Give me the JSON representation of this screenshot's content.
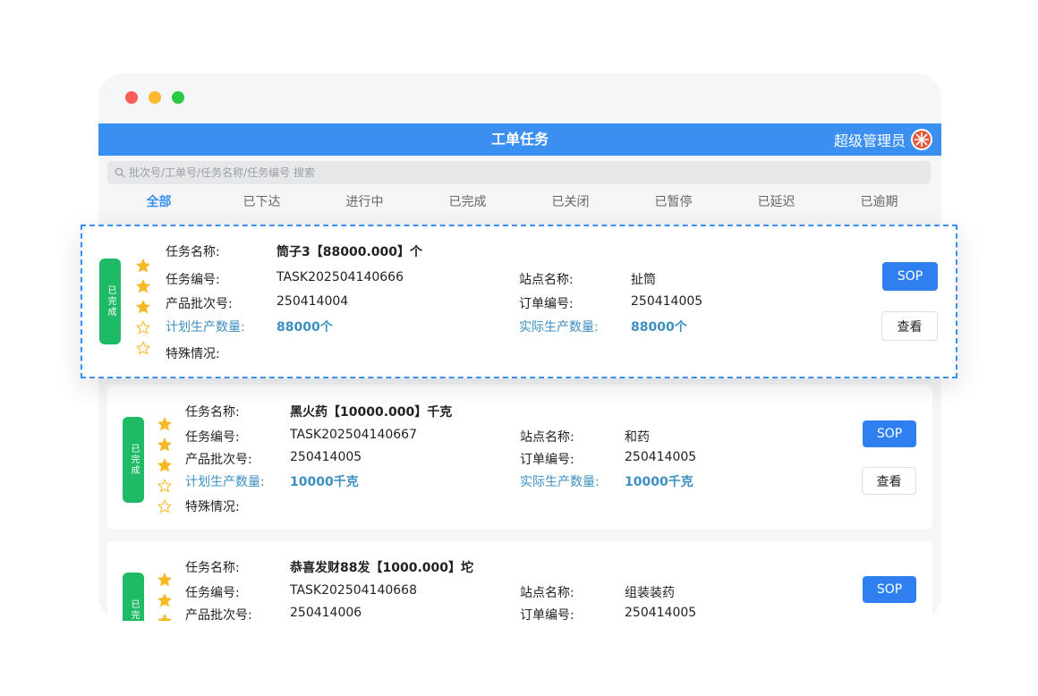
{
  "header": {
    "title": "工单任务",
    "user": "超级管理员"
  },
  "search": {
    "placeholder": "批次号/工单号/任务名称/任务编号 搜索"
  },
  "tabs": [
    "全部",
    "已下达",
    "进行中",
    "已完成",
    "已关闭",
    "已暂停",
    "已延迟",
    "已逾期"
  ],
  "labels": {
    "task_name": "任务名称:",
    "task_no": "任务编号:",
    "batch_no": "产品批次号:",
    "planned_qty": "计划生产数量:",
    "special": "特殊情况:",
    "station": "站点名称:",
    "order_no": "订单编号:",
    "actual_qty": "实际生产数量:",
    "sop_button": "SOP",
    "view_button": "查看"
  },
  "tasks": [
    {
      "status": "已完成",
      "rating": 3,
      "name": "筒子3【88000.000】个",
      "task_no": "TASK202504140666",
      "batch_no": "250414004",
      "planned_qty": "88000个",
      "station": "扯筒",
      "order_no": "250414005",
      "actual_qty": "88000个",
      "special": ""
    },
    {
      "status": "已完成",
      "rating": 3,
      "name": "黑火药【10000.000】千克",
      "task_no": "TASK202504140667",
      "batch_no": "250414005",
      "planned_qty": "10000千克",
      "station": "和药",
      "order_no": "250414005",
      "actual_qty": "10000千克",
      "special": ""
    },
    {
      "status": "已完成",
      "rating": 3,
      "name": "恭喜发财88发【1000.000】坨",
      "task_no": "TASK202504140668",
      "batch_no": "250414006",
      "station": "组装装药",
      "order_no": "250414005"
    }
  ],
  "colors": {
    "accent": "#3b8ff0",
    "status_green": "#1fba66",
    "star": "#f7b924",
    "link_blue": "#3c8fc2"
  }
}
